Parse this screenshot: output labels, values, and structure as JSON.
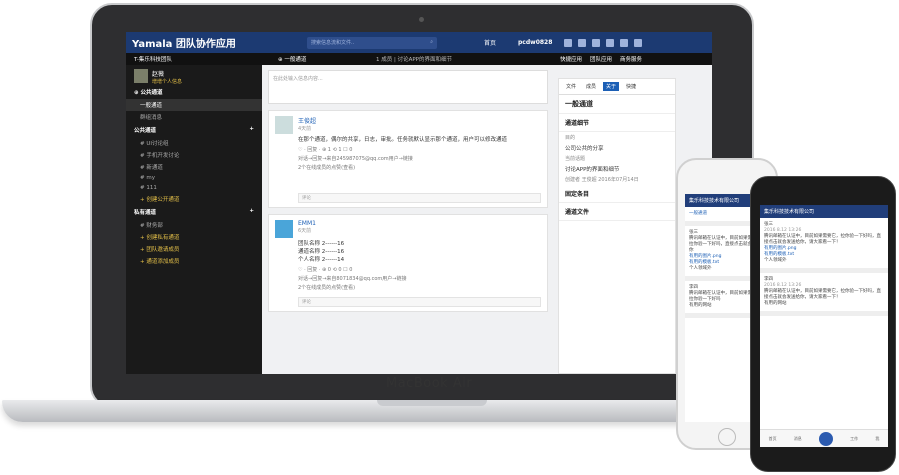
{
  "app": {
    "logo": "Yamala 团队协作应用",
    "search_placeholder": "搜索信息流和文件..",
    "nav_home": "首页",
    "user": "pcdw0828"
  },
  "bar2": {
    "team": "T-集乐科技团队",
    "channel": "⊕ 一般通道",
    "desc": "1 成员 | 讨论APP的界面和细节",
    "links": [
      "快捷应用",
      "团队应用",
      "商务服务"
    ]
  },
  "sidebar": {
    "name": "赵薇",
    "status": "增增个人信息",
    "public_header": "⊕ 公共通道",
    "items1": [
      "一般通道",
      "群组消息"
    ],
    "channel_header": "公共通道",
    "items2": [
      "# UI讨论组",
      "# 手机开发讨论",
      "# 新通道",
      "# my",
      "# 111"
    ],
    "create_public": "+ 创建公开通道",
    "private_header": "私有通道",
    "private_items": [
      "# 财务部"
    ],
    "create_private": "+ 创建私有通道",
    "invite": "+ 团队邀请成员",
    "add_channel": "+ 通道添加成员"
  },
  "compose": {
    "placeholder": "在此处输入信息内容..."
  },
  "posts": [
    {
      "name": "王俊超",
      "time": "4天前",
      "body": "在那个通道，偶尔的共享，日志，审批。任务就默认显示那个通道，用户可以修改通道",
      "meta": "♡ ·  回复 · ⊕ 1 ⟲ 1 ☐ 0",
      "sub": "对话→回复→来自245987075@qq.com用户→链接",
      "sub2": "2个在线成员的点赞(查看)",
      "comment": "评论"
    },
    {
      "name": "EMM1",
      "time": "6天前",
      "lines": [
        "团队名称  2------16",
        "通道名称  2------16",
        "个人名称  2------14"
      ],
      "meta": "♡ ·  回复 · ⊕ 0 ⟲ 0 ☐ 0",
      "sub": "对话→回复→来自8071834@qq.com用户→链接",
      "sub2": "2个在线成员的点赞(查看)",
      "comment": "评论"
    }
  ],
  "right": {
    "tabs": [
      "文件",
      "成员",
      "关于",
      "快捷"
    ],
    "active_tab": "关于",
    "title": "一般通道",
    "detail": "通道细节",
    "purpose_label": "目的",
    "purpose": "公司公共的分享",
    "topic_label": "当前话题",
    "topic": "讨论APP的界面和细节",
    "created": "创建者 王俊超 2016年07月14日",
    "pinned": "固定条目",
    "files": "通道文件"
  },
  "laptop": {
    "brand": "MacBook Air"
  },
  "phone_small": {
    "header": "集乐科技技术有限公司",
    "sub": "一般通道",
    "cards": [
      {
        "name": "张三",
        "text": "腾讯邮箱在认证中，目前如果需要它，拉你验一下好吗，直接点击就会发送给你",
        "file1": "有用的图片.png",
        "file2": "有用的模板.txt",
        "foot": "个人领域外"
      },
      {
        "name": "李四",
        "text": "腾讯邮箱在认证中，目前如果需要它，拉你验一下好吗",
        "foot": "有用的网站"
      }
    ]
  },
  "phone_big": {
    "header": "集乐科技技术有限公司",
    "cards": [
      {
        "name": "张三",
        "date": "2016 8.12  13:26",
        "text": "腾讯邮箱在认证中，目前如果需要它，拉你验一下好吗，直接点击就会发送给你，请大家看一下！",
        "file1": "有用的图片.png",
        "file2": "有用的模板.txt",
        "foot": "个人领域外"
      },
      {
        "name": "李四",
        "date": "2016 8.12  13:26",
        "text": "腾讯邮箱在认证中，目前如果需要它，拉你验一下好吗，直接点击就会发送给你，请大家看一下！",
        "foot": "有用的网站"
      }
    ],
    "tabs": [
      "首页",
      "消息",
      "",
      "工作",
      "我"
    ]
  }
}
